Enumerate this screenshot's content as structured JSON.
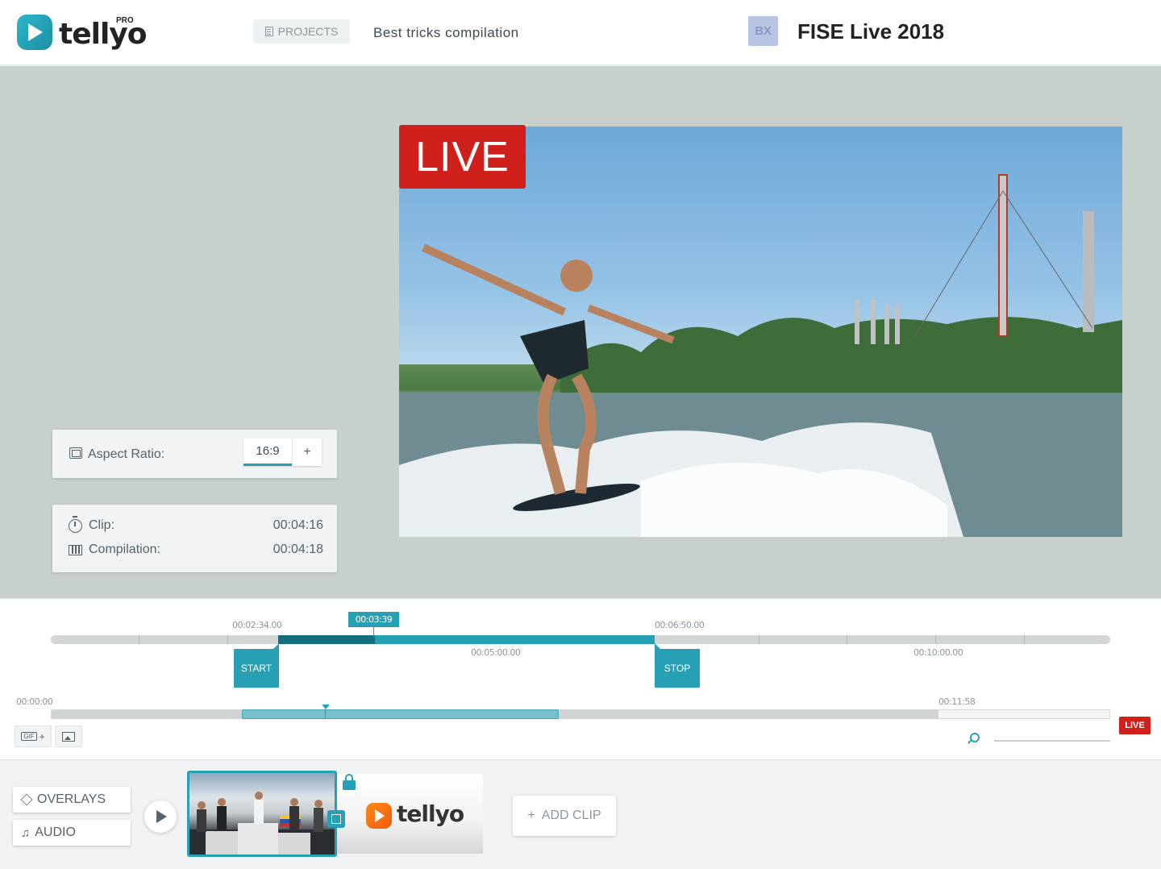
{
  "header": {
    "logo_text": "tellyo",
    "logo_badge": "PRO",
    "projects_label": "PROJECTS",
    "project_name": "Best tricks compilation",
    "channel_initials": "BX",
    "event_title": "FISE Live 2018"
  },
  "preview": {
    "live_label": "LIVE"
  },
  "aspect_ratio": {
    "label": "Aspect Ratio:",
    "value": "16:9",
    "add_label": "+"
  },
  "durations": {
    "clip_label": "Clip:",
    "clip_value": "00:04:16",
    "compilation_label": "Compilation:",
    "compilation_value": "00:04:18"
  },
  "timeline": {
    "start_time": "00:02:34.00",
    "playhead_time": "00:03:39",
    "stop_time": "00:06:50.00",
    "tick_5min": "00:05:00.00",
    "tick_10min": "00:10:00.00",
    "start_label": "START",
    "stop_label": "STOP",
    "overview_start": "00:00:00",
    "overview_end": "00:11:58",
    "gif_label": "GIF",
    "gif_plus": "+",
    "live_label": "LIVE"
  },
  "bottom": {
    "overlays_label": "OVERLAYS",
    "audio_label": "AUDIO",
    "outro_text": "tellyo",
    "add_clip_plus": "+",
    "add_clip_label": "ADD CLIP"
  },
  "icons": [
    "document-icon",
    "aspect-ratio-icon",
    "stopwatch-icon",
    "film-icon",
    "image-icon",
    "zoom-icon",
    "layers-icon",
    "music-note-icon",
    "play-icon",
    "lock-icon",
    "expand-icon"
  ],
  "colors": {
    "accent": "#27a0b3",
    "accent_dark": "#136f7e",
    "live_red": "#d0201c"
  }
}
